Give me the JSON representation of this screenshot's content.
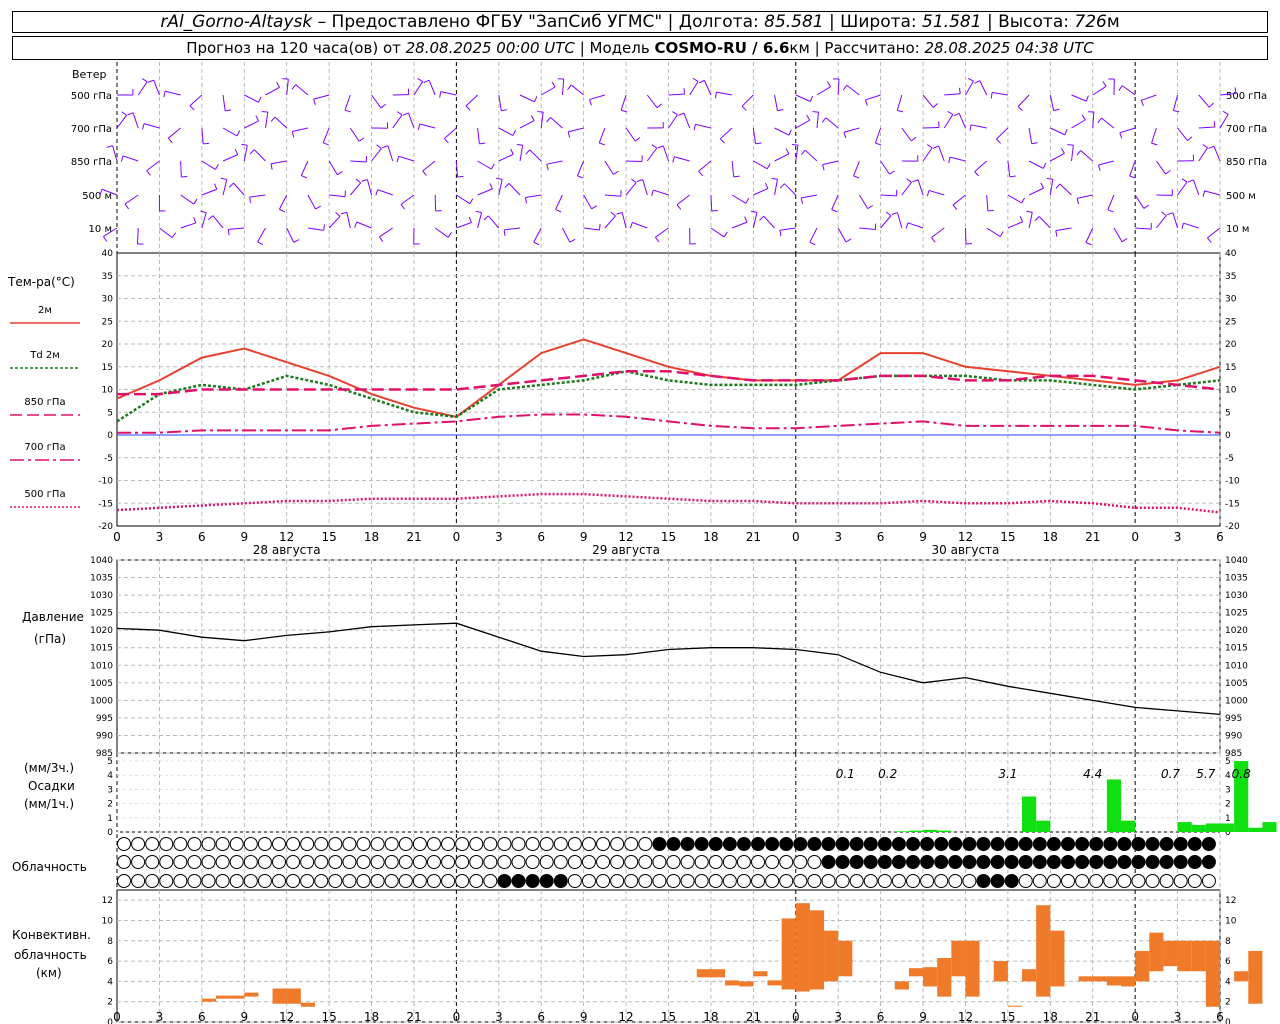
{
  "header": {
    "station": "rAl_Gorno-Altaysk",
    "provider": "– Предоставлено ФГБУ \"ЗапСиб УГМС\"",
    "lon_label": "Долгота:",
    "lon": "85.581",
    "lat_label": "Широта:",
    "lat": "51.581",
    "alt_label": "Высота:",
    "alt": "726",
    "alt_unit": "м",
    "forecast_label": "Прогноз на 120 часа(ов)  от",
    "forecast_start": "28.08.2025 00:00 UTC",
    "model_label": "| Модель",
    "model": "COSMO-RU / 6.6",
    "model_unit": "км",
    "calc_label": "| Рассчитано:",
    "calc_time": "28.08.2025 04:38 UTC"
  },
  "wind_panel": {
    "title": "Ветер",
    "levels": [
      "500 гПа",
      "700 гПа",
      "850 гПа",
      "500  м",
      "10  м"
    ]
  },
  "temp_panel": {
    "title": "Тем-ра(°C)",
    "legend": [
      "2м",
      "Td  2м",
      "850 гПа",
      "700 гПа",
      "500 гПа"
    ],
    "y_ticks": [
      "40",
      "35",
      "30",
      "25",
      "20",
      "15",
      "10",
      "5",
      "0",
      "-5",
      "-10",
      "-15",
      "-20"
    ]
  },
  "x_axis": {
    "hour_ticks": [
      "0",
      "3",
      "6",
      "9",
      "12",
      "15",
      "18",
      "21",
      "0",
      "3",
      "6",
      "9",
      "12",
      "15",
      "18",
      "21",
      "0",
      "3",
      "6",
      "9",
      "12",
      "15",
      "18",
      "21",
      "0",
      "3",
      "6"
    ],
    "days": [
      "28 августа",
      "29 августа",
      "30 августа"
    ]
  },
  "pressure_panel": {
    "title": "Давление",
    "unit": "(гПа)",
    "y_ticks": [
      "1040",
      "1035",
      "1030",
      "1025",
      "1020",
      "1015",
      "1010",
      "1005",
      "1000",
      "995",
      "990",
      "985"
    ]
  },
  "precip_panel": {
    "unit_top": "(мм/3ч.)",
    "title": "Осадки",
    "unit_bottom": "(мм/1ч.)",
    "y_ticks": [
      "5",
      "4",
      "3",
      "2",
      "1",
      "0"
    ],
    "totals": [
      "0.1",
      "0.2",
      "3.1",
      "4.4",
      "0.7",
      "5.7",
      "0.8"
    ]
  },
  "cloud_panel": {
    "title": "Облачность"
  },
  "conv_panel": {
    "title_1": "Конвективн.",
    "title_2": "облачность",
    "unit": "(км)",
    "y_ticks": [
      "12",
      "10",
      "8",
      "6",
      "4",
      "2",
      "0"
    ]
  },
  "colors": {
    "wind": "#8000ff",
    "t2m": "#e8402e",
    "td2m": "#1e7a1e",
    "t850": "#e0106a",
    "t700": "#e0106a",
    "t500": "#e0106a",
    "zero_line": "#2040ff",
    "precip": "#10e010",
    "conv": "#ee7a2a"
  },
  "chart_data": [
    {
      "type": "line",
      "title": "Тем-ра(°C)",
      "xlabel": "",
      "ylabel": "°C",
      "ylim": [
        -20,
        40
      ],
      "x_hours": [
        0,
        3,
        6,
        9,
        12,
        15,
        18,
        21,
        24,
        27,
        30,
        33,
        36,
        39,
        42,
        45,
        48,
        51,
        54,
        57,
        60,
        63,
        66,
        69,
        72,
        75,
        78
      ],
      "series": [
        {
          "name": "2м",
          "values": [
            8,
            12,
            17,
            19,
            16,
            13,
            9,
            6,
            4,
            11,
            18,
            21,
            18,
            15,
            13,
            12,
            12,
            12,
            18,
            18,
            15,
            14,
            13,
            12,
            11,
            12,
            15
          ]
        },
        {
          "name": "Td  2м",
          "values": [
            3,
            9,
            11,
            10,
            13,
            11,
            8,
            5,
            4,
            10,
            11,
            12,
            14,
            12,
            11,
            11,
            11,
            12,
            13,
            13,
            13,
            12,
            12,
            11,
            10,
            11,
            12
          ]
        },
        {
          "name": "850 гПа",
          "values": [
            9,
            9,
            10,
            10,
            10,
            10,
            10,
            10,
            10,
            11,
            12,
            13,
            14,
            14,
            13,
            12,
            12,
            12,
            13,
            13,
            12,
            12,
            13,
            13,
            12,
            11,
            10
          ]
        },
        {
          "name": "700 гПа",
          "values": [
            0.5,
            0.5,
            1,
            1,
            1,
            1,
            2,
            2.5,
            3,
            4,
            4.5,
            4.5,
            4,
            3,
            2,
            1.5,
            1.5,
            2,
            2.5,
            3,
            2,
            2,
            2,
            2,
            2,
            1,
            0.5
          ]
        },
        {
          "name": "500 гПа",
          "values": [
            -16.5,
            -16,
            -15.5,
            -15,
            -14.5,
            -14.5,
            -14,
            -14,
            -14,
            -13.5,
            -13,
            -13,
            -13.5,
            -14,
            -14.5,
            -14.5,
            -15,
            -15,
            -15,
            -14.5,
            -15,
            -15,
            -14.5,
            -15,
            -16,
            -16,
            -17
          ]
        }
      ]
    },
    {
      "type": "line",
      "title": "Давление",
      "xlabel": "",
      "ylabel": "гПа",
      "ylim": [
        985,
        1040
      ],
      "x_hours": [
        0,
        3,
        6,
        9,
        12,
        15,
        18,
        21,
        24,
        27,
        30,
        33,
        36,
        39,
        42,
        45,
        48,
        51,
        54,
        57,
        60,
        63,
        66,
        69,
        72,
        75,
        78
      ],
      "series": [
        {
          "name": "Давление",
          "values": [
            1020.5,
            1020,
            1018,
            1017,
            1018.5,
            1019.5,
            1021,
            1021.5,
            1022,
            1018,
            1014,
            1012.5,
            1013,
            1014.5,
            1015,
            1015,
            1014.5,
            1013,
            1008,
            1005,
            1006.5,
            1004,
            1002,
            1000,
            998,
            997,
            996
          ]
        }
      ]
    },
    {
      "type": "bar",
      "title": "Осадки",
      "xlabel": "",
      "ylabel": "мм",
      "ylim": [
        0,
        5
      ],
      "x_hours": [
        55,
        56,
        57,
        58,
        64,
        65,
        70,
        71,
        75,
        76,
        77,
        78,
        79,
        80,
        81
      ],
      "values": [
        0.05,
        0.1,
        0.15,
        0.1,
        2.5,
        0.8,
        3.7,
        0.8,
        0.7,
        0.5,
        0.6,
        0.6,
        5.0,
        0.3,
        0.7
      ]
    },
    {
      "type": "bar",
      "title": "Конвективн. облачность",
      "xlabel": "",
      "ylabel": "км",
      "ylim": [
        0,
        12
      ],
      "segments": [
        [
          6,
          7,
          2.0,
          2.3
        ],
        [
          7,
          8,
          2.3,
          2.6
        ],
        [
          8,
          9,
          2.3,
          2.6
        ],
        [
          9,
          10,
          2.5,
          2.9
        ],
        [
          11,
          12,
          1.8,
          3.3
        ],
        [
          12,
          13,
          1.8,
          3.3
        ],
        [
          13,
          14,
          1.5,
          1.9
        ],
        [
          41,
          42,
          4.4,
          5.2
        ],
        [
          42,
          43,
          4.4,
          5.2
        ],
        [
          43,
          44,
          3.6,
          4.1
        ],
        [
          44,
          45,
          3.5,
          4.0
        ],
        [
          45,
          46,
          4.5,
          5.0
        ],
        [
          46,
          47,
          3.6,
          4.1
        ],
        [
          47,
          48,
          3.2,
          10.2
        ],
        [
          48,
          49,
          3.0,
          11.7
        ],
        [
          49,
          50,
          3.2,
          11.0
        ],
        [
          50,
          51,
          4.0,
          9.0
        ],
        [
          51,
          52,
          4.5,
          8.0
        ],
        [
          55,
          56,
          3.2,
          4.0
        ],
        [
          56,
          57,
          4.5,
          5.3
        ],
        [
          57,
          58,
          3.5,
          5.4
        ],
        [
          58,
          59,
          2.5,
          6.3
        ],
        [
          59,
          60,
          4.5,
          8.0
        ],
        [
          60,
          61,
          2.5,
          8.0
        ],
        [
          62,
          63,
          4.0,
          6.0
        ],
        [
          63,
          64,
          1.5,
          1.6
        ],
        [
          64,
          65,
          4.0,
          5.2
        ],
        [
          65,
          66,
          2.5,
          11.5
        ],
        [
          66,
          67,
          3.5,
          9.0
        ],
        [
          68,
          69,
          4.0,
          4.5
        ],
        [
          69,
          70,
          4.0,
          4.5
        ],
        [
          70,
          71,
          3.6,
          4.5
        ],
        [
          71,
          72,
          3.5,
          4.5
        ],
        [
          72,
          73,
          4.0,
          7.0
        ],
        [
          73,
          74,
          5.0,
          8.8
        ],
        [
          74,
          75,
          5.5,
          8.0
        ],
        [
          75,
          76,
          5.0,
          8.0
        ],
        [
          76,
          77,
          5.0,
          8.0
        ],
        [
          77,
          78,
          1.5,
          8.0
        ],
        [
          79,
          80,
          4.0,
          5.0
        ],
        [
          80,
          81,
          1.8,
          7.0
        ]
      ]
    }
  ]
}
